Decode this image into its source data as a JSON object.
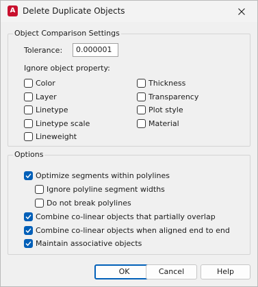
{
  "window": {
    "title": "Delete Duplicate Objects",
    "app_icon_letter": "A",
    "close_glyph": "close-icon"
  },
  "comparison": {
    "legend": "Object Comparison Settings",
    "tolerance_label": "Tolerance:",
    "tolerance_value": "0.000001",
    "ignore_label": "Ignore object property:",
    "properties_left": [
      {
        "label": "Color",
        "checked": false
      },
      {
        "label": "Layer",
        "checked": false
      },
      {
        "label": "Linetype",
        "checked": false
      },
      {
        "label": "Linetype scale",
        "checked": false
      },
      {
        "label": "Lineweight",
        "checked": false
      }
    ],
    "properties_right": [
      {
        "label": "Thickness",
        "checked": false
      },
      {
        "label": "Transparency",
        "checked": false
      },
      {
        "label": "Plot style",
        "checked": false
      },
      {
        "label": "Material",
        "checked": false
      }
    ]
  },
  "options": {
    "legend": "Options",
    "optimize_segments": {
      "label": "Optimize segments within polylines",
      "checked": true
    },
    "ignore_widths": {
      "label": "Ignore polyline segment widths",
      "checked": false
    },
    "do_not_break": {
      "label": "Do not break polylines",
      "checked": false
    },
    "combine_overlap": {
      "label": "Combine co-linear objects that partially overlap",
      "checked": true
    },
    "combine_end": {
      "label": "Combine co-linear objects when aligned end to end",
      "checked": true
    },
    "maintain_assoc": {
      "label": "Maintain associative objects",
      "checked": true
    }
  },
  "buttons": {
    "ok": "OK",
    "cancel": "Cancel",
    "help": "Help"
  },
  "colors": {
    "accent": "#005fb8",
    "app_icon": "#c8102e"
  }
}
